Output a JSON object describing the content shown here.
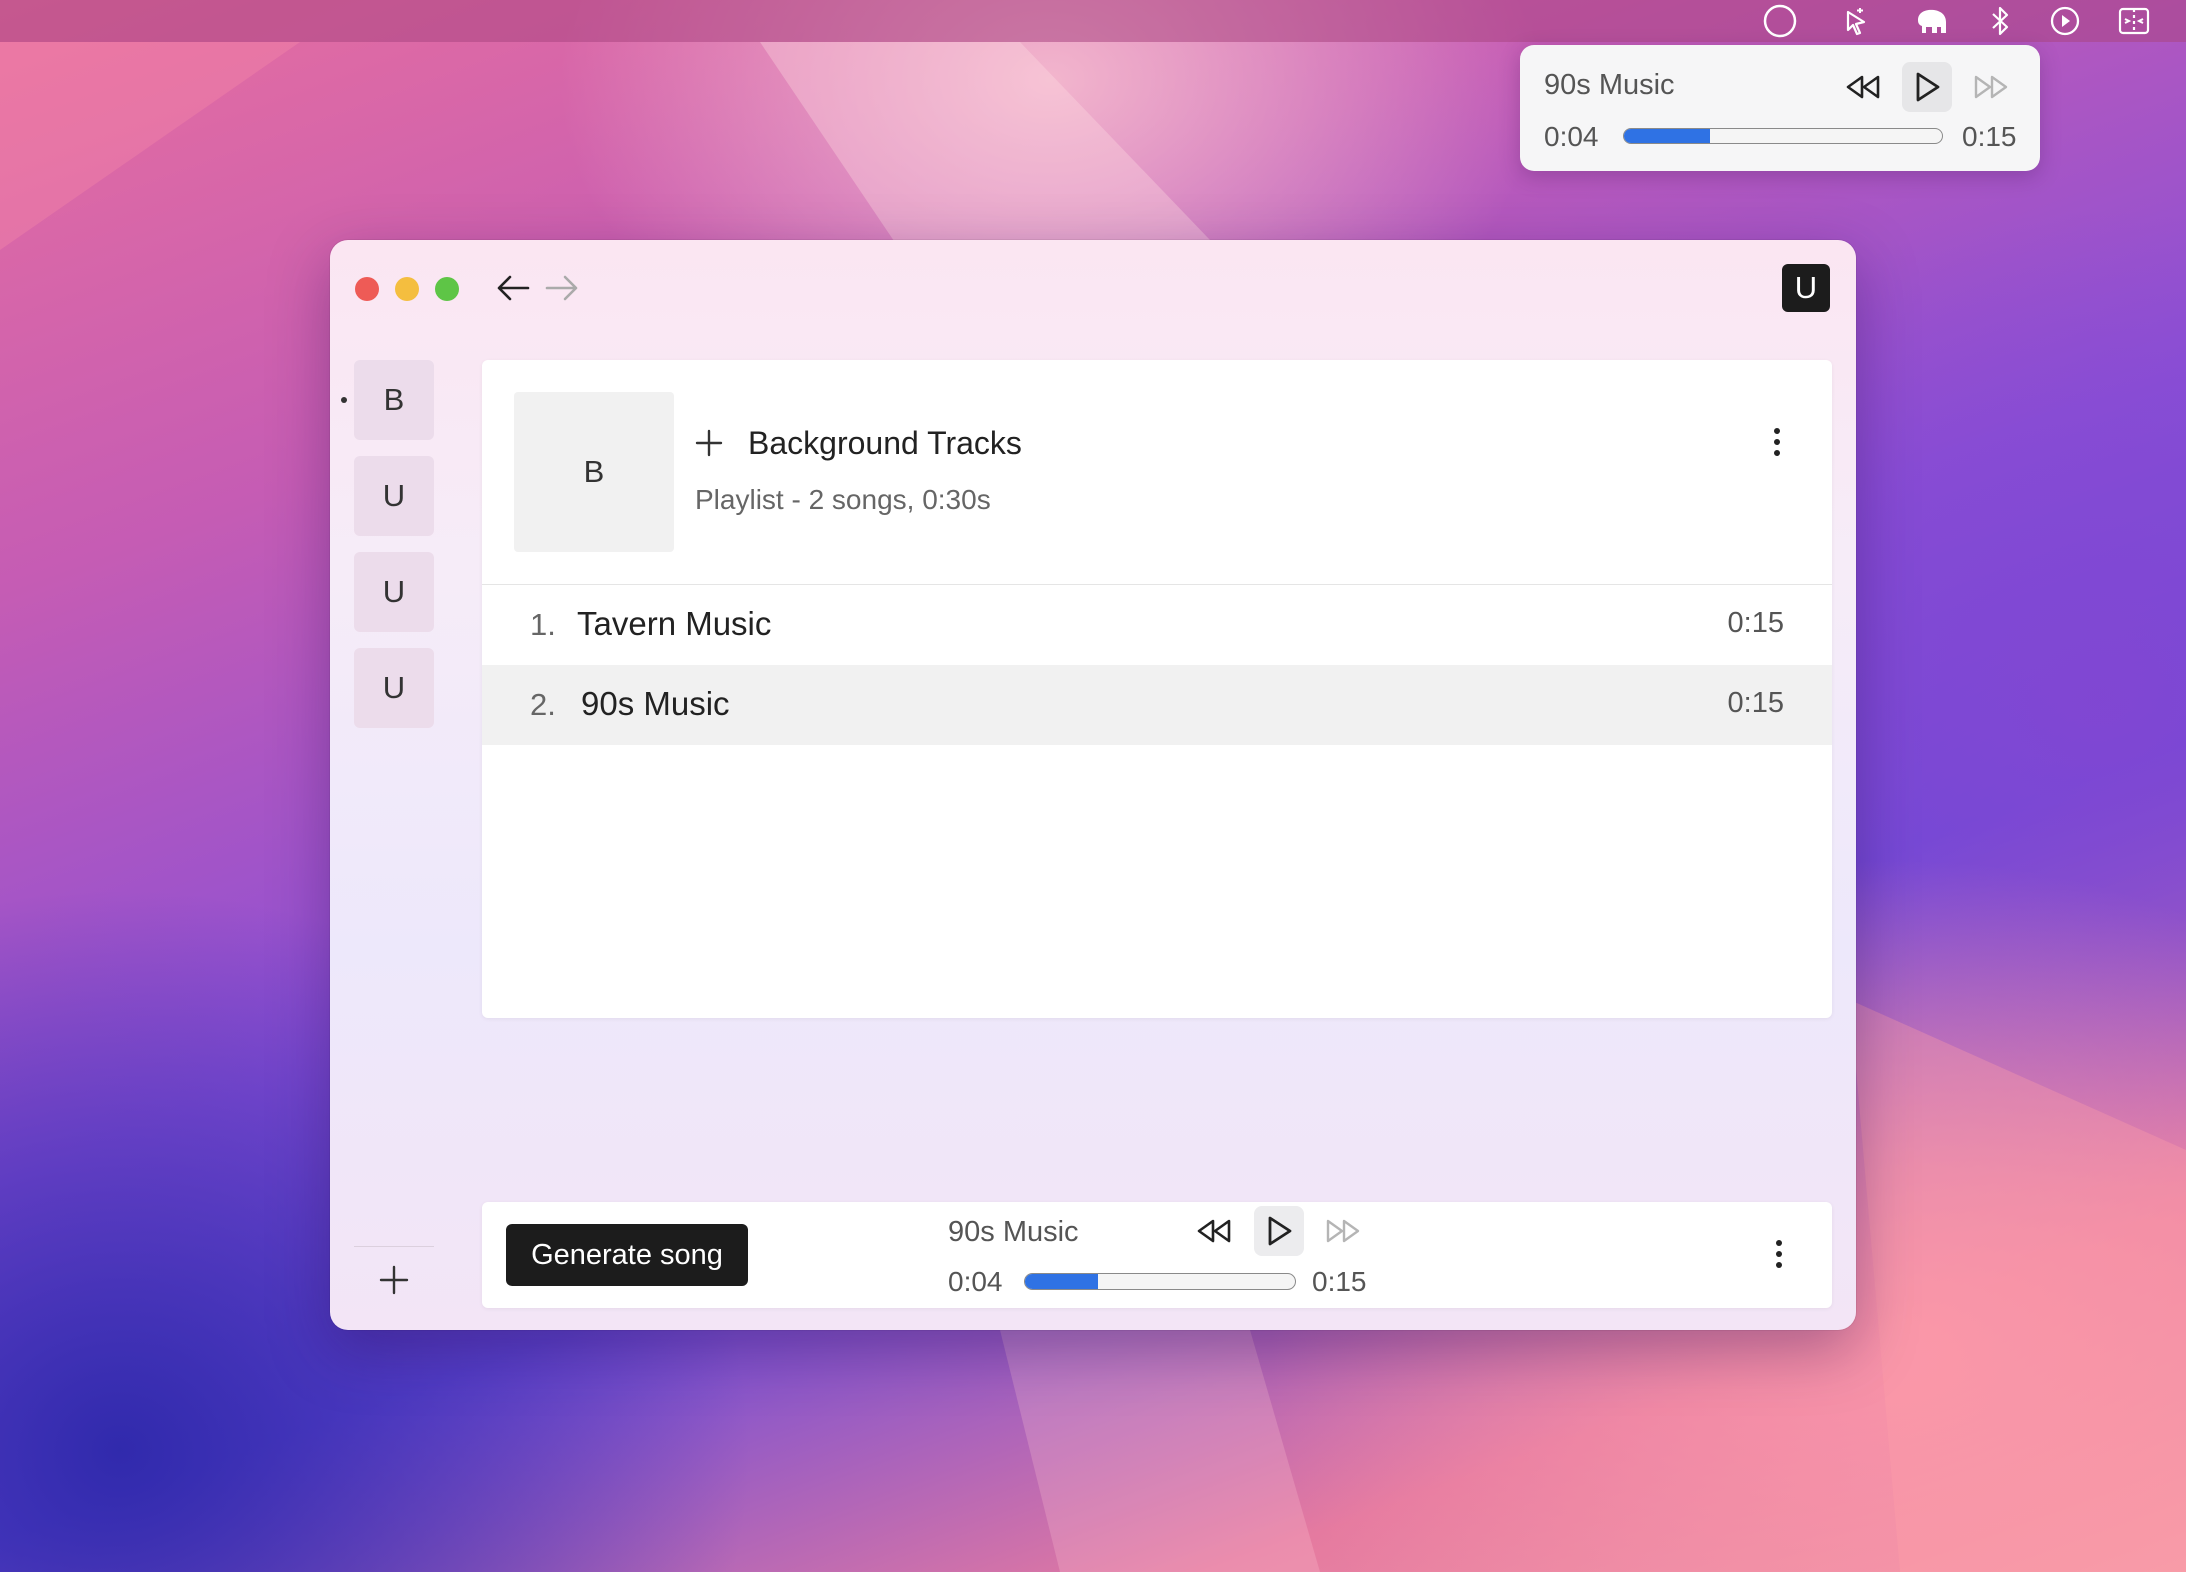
{
  "menubar": {
    "icons": [
      "circle-status-icon",
      "sparkle-cursor-icon",
      "elephant-icon",
      "bluetooth-icon",
      "play-circle-icon",
      "split-screen-icon"
    ]
  },
  "mini_player": {
    "title": "90s Music",
    "current_time": "0:04",
    "total_time": "0:15",
    "progress": 0.27,
    "accent": "#2f72e4"
  },
  "window": {
    "user_initial": "U",
    "sidebar": {
      "items": [
        {
          "label": "B",
          "active": true
        },
        {
          "label": "U"
        },
        {
          "label": "U"
        },
        {
          "label": "U"
        }
      ]
    },
    "playlist": {
      "cover_initial": "B",
      "title": "Background Tracks",
      "subtitle": "Playlist - 2 songs, 0:30s",
      "tracks": [
        {
          "number": "1.",
          "name": "Tavern Music",
          "duration": "0:15",
          "selected": false
        },
        {
          "number": "2.",
          "name": "90s Music",
          "duration": "0:15",
          "selected": true
        }
      ]
    },
    "player": {
      "generate_label": "Generate song",
      "title": "90s Music",
      "current_time": "0:04",
      "total_time": "0:15",
      "progress": 0.27,
      "accent": "#2f72e4"
    }
  },
  "colors": {
    "traffic_close": "#ee5b56",
    "traffic_minimize": "#f4be3f",
    "traffic_zoom": "#5ec546",
    "dark_button": "#1c1c1c"
  }
}
